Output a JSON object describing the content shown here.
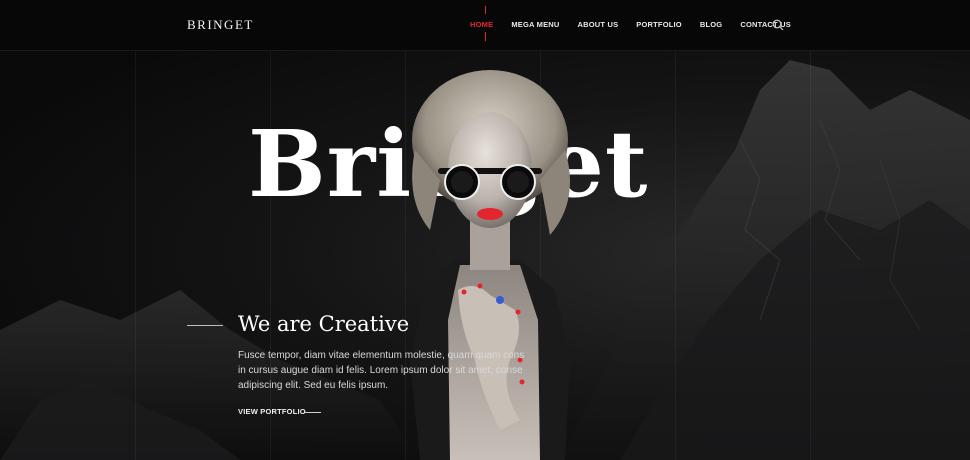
{
  "header": {
    "logo": "BRINGET",
    "nav": [
      {
        "label": "HOME",
        "active": true
      },
      {
        "label": "MEGA MENU",
        "active": false
      },
      {
        "label": "ABOUT US",
        "active": false
      },
      {
        "label": "PORTFOLIO",
        "active": false
      },
      {
        "label": "BLOG",
        "active": false
      },
      {
        "label": "CONTACT US",
        "active": false
      }
    ],
    "search_icon": "search-icon"
  },
  "hero": {
    "title": "Bringet",
    "tagline": "We are Creative",
    "description": [
      "Fusce tempor, diam vitae elementum molestie, quam quam cons",
      "in cursus augue diam id felis. Lorem ipsum dolor sit amet, conse",
      "adipiscing elit. Sed eu felis ipsum."
    ],
    "cta_label": "VIEW PORTFOLIO"
  },
  "colors": {
    "accent": "#e3262e",
    "background": "#0b0b0c",
    "text": "#ffffff"
  }
}
